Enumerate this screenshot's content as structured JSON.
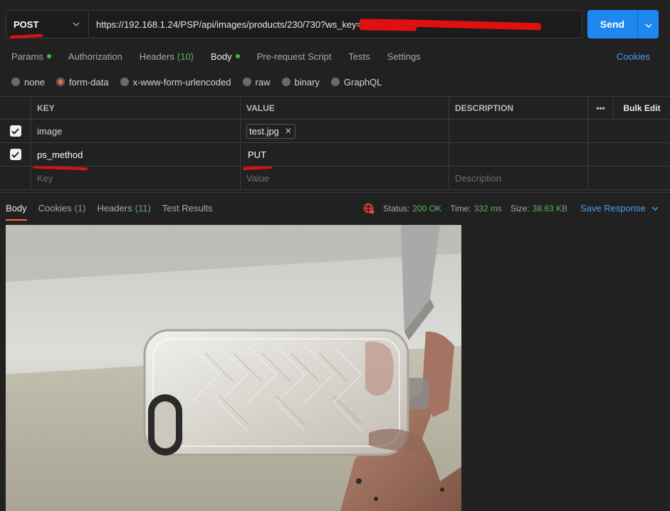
{
  "request": {
    "method": "POST",
    "url": "https://192.168.1.24/PSP/api/images/products/230/730?ws_key=M",
    "send_label": "Send"
  },
  "req_tabs": {
    "params": "Params",
    "authorization": "Authorization",
    "headers": "Headers",
    "headers_count": "(10)",
    "body": "Body",
    "prerequest": "Pre-request Script",
    "tests": "Tests",
    "settings": "Settings",
    "cookies": "Cookies"
  },
  "body_types": [
    "none",
    "form-data",
    "x-www-form-urlencoded",
    "raw",
    "binary",
    "GraphQL"
  ],
  "table": {
    "headers": {
      "key": "KEY",
      "value": "VALUE",
      "description": "DESCRIPTION",
      "bulk_edit": "Bulk Edit",
      "more": "•••"
    },
    "rows": [
      {
        "key": "image",
        "value": "test.jpg",
        "file_remove": "✕"
      },
      {
        "key": "ps_method",
        "value": "PUT"
      }
    ],
    "placeholders": {
      "key": "Key",
      "value": "Value",
      "description": "Description"
    }
  },
  "response": {
    "tabs": {
      "body": "Body",
      "cookies": "Cookies",
      "cookies_count": "(1)",
      "headers": "Headers",
      "headers_count": "(11)",
      "test_results": "Test Results"
    },
    "status_label": "Status:",
    "status_value": "200 OK",
    "time_label": "Time:",
    "time_value": "332 ms",
    "size_label": "Size:",
    "size_value": "38.63 KB",
    "save_response": "Save Response"
  },
  "colors": {
    "accent_orange": "#ff6c37",
    "send_blue": "#1e87f0",
    "status_green": "#5fb360",
    "annotation_red": "#e01010"
  }
}
